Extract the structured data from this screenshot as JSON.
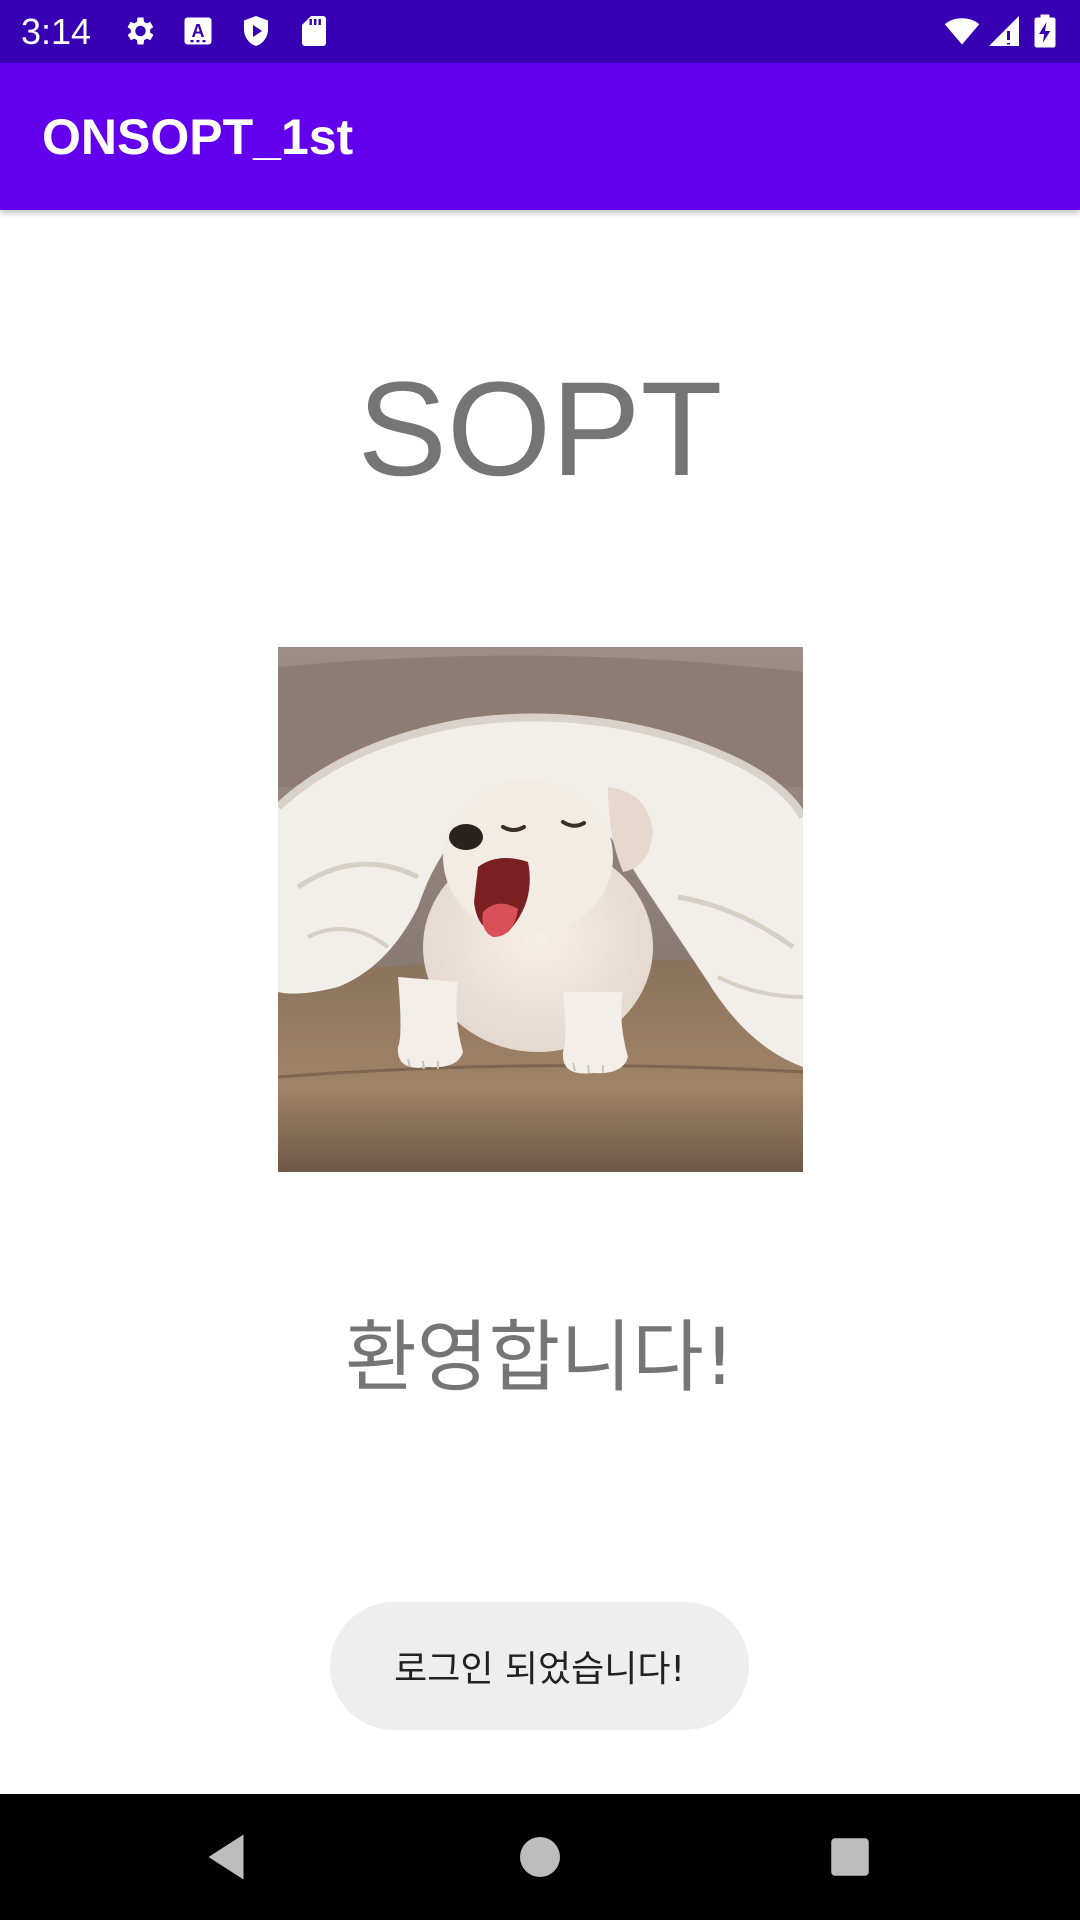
{
  "status_bar": {
    "time": "3:14",
    "background": "#3700B3",
    "left_icons": [
      "settings-gear-icon",
      "keyboard-a-icon",
      "shield-play-icon",
      "sd-card-icon"
    ],
    "right_icons": [
      "wifi-icon",
      "cellular-signal-icon",
      "battery-charging-icon"
    ]
  },
  "app_bar": {
    "title": "ONSOPT_1st",
    "background": "#6200EE"
  },
  "main": {
    "logo_text": "SOPT",
    "photo": "puppy-under-blanket-yawning",
    "welcome_text": "환영합니다!"
  },
  "toast": {
    "message": "로그인 되었습니다!"
  },
  "nav_bar": {
    "buttons": [
      "back-icon",
      "home-icon",
      "recents-icon"
    ]
  }
}
